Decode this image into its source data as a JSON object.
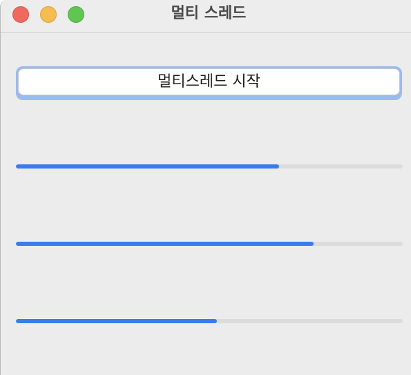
{
  "window": {
    "title": "멀티 스레드"
  },
  "controls": {
    "start_label": "멀티스레드 시작"
  },
  "progress_bars": [
    {
      "value": 0.68
    },
    {
      "value": 0.77
    },
    {
      "value": 0.52
    }
  ],
  "colors": {
    "progress_fill": "#3a7cea",
    "progress_track": "#dcdcdc",
    "focus_ring": "#9bbaf0",
    "close": "#ee6a5f",
    "minimize": "#f5bd4f",
    "zoom": "#61c554"
  }
}
